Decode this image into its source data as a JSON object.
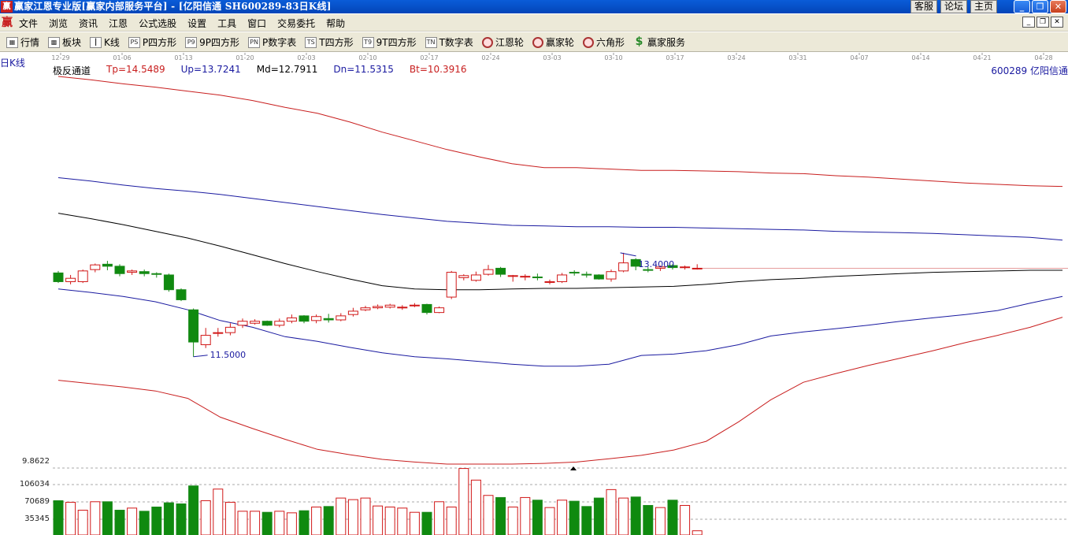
{
  "window": {
    "title": "赢家江恩专业版[赢家内部服务平台] - [亿阳信通   SH600289-83日K线]",
    "app_icon": "赢",
    "links": [
      "客服",
      "论坛",
      "主页"
    ],
    "buttons": {
      "minimize": "_",
      "restore": "❐",
      "close": "✕"
    }
  },
  "menu": {
    "logo": "赢",
    "items": [
      "文件",
      "浏览",
      "资讯",
      "江恩",
      "公式选股",
      "设置",
      "工具",
      "窗口",
      "交易委托",
      "帮助"
    ]
  },
  "toolbar": {
    "items": [
      {
        "label": "行情",
        "icon": "grid-icon",
        "glyph": "▦"
      },
      {
        "label": "板块",
        "icon": "blocks-icon",
        "glyph": "▩"
      },
      {
        "label": "K线",
        "icon": "candlestick-icon",
        "glyph": "┃"
      },
      {
        "label": "P四方形",
        "icon": "ps-icon",
        "glyph": "PS"
      },
      {
        "label": "9P四方形",
        "icon": "p9-icon",
        "glyph": "P9"
      },
      {
        "label": "P数字表",
        "icon": "pn-icon",
        "glyph": "PN"
      },
      {
        "label": "T四方形",
        "icon": "ts-icon",
        "glyph": "TS"
      },
      {
        "label": "9T四方形",
        "icon": "t9-icon",
        "glyph": "T9"
      },
      {
        "label": "T数字表",
        "icon": "tn-icon",
        "glyph": "TN"
      },
      {
        "label": "江恩轮",
        "icon": "gann-wheel-icon",
        "glyph": ""
      },
      {
        "label": "赢家轮",
        "icon": "winner-wheel-icon",
        "glyph": ""
      },
      {
        "label": "六角形",
        "icon": "hexagon-icon",
        "glyph": ""
      },
      {
        "label": "赢家服务",
        "icon": "dollar-icon",
        "glyph": "$"
      }
    ]
  },
  "chart_header": {
    "period": "日K线",
    "indicator_name": "极反通道",
    "indicator_values": [
      {
        "label": "Tp=14.5489",
        "color": "#c81e1e"
      },
      {
        "label": "Up=13.7241",
        "color": "#1a1aa0"
      },
      {
        "label": "Md=12.7911",
        "color": "#000000"
      },
      {
        "label": "Dn=11.5315",
        "color": "#1a1aa0"
      },
      {
        "label": "Bt=10.3916",
        "color": "#c81e1e"
      }
    ],
    "stock": "600289 亿阳信通"
  },
  "chart_data": {
    "type": "candlestick",
    "date_ticks": [
      "12-29",
      "01-06",
      "01-13",
      "01-20",
      "02-03",
      "02-10",
      "02-17",
      "02-24",
      "03-03",
      "03-10",
      "03-17",
      "03-24",
      "03-31",
      "04-07",
      "04-14",
      "04-21",
      "04-28"
    ],
    "annotations": {
      "low_marker": "11.5000",
      "high_marker": "13.4000"
    },
    "candles": [
      [
        12.75,
        12.62,
        12.78,
        12.6
      ],
      [
        12.62,
        12.67,
        12.72,
        12.58
      ],
      [
        12.62,
        12.78,
        12.8,
        12.6
      ],
      [
        12.8,
        12.87,
        12.89,
        12.76
      ],
      [
        12.88,
        12.85,
        12.93,
        12.79
      ],
      [
        12.85,
        12.74,
        12.88,
        12.7
      ],
      [
        12.76,
        12.78,
        12.8,
        12.72
      ],
      [
        12.77,
        12.74,
        12.8,
        12.7
      ],
      [
        12.74,
        12.73,
        12.76,
        12.68
      ],
      [
        12.72,
        12.5,
        12.74,
        12.47
      ],
      [
        12.5,
        12.35,
        12.52,
        12.33
      ],
      [
        12.2,
        11.72,
        12.22,
        11.5
      ],
      [
        11.68,
        11.82,
        11.93,
        11.63
      ],
      [
        11.85,
        11.86,
        11.93,
        11.8
      ],
      [
        11.86,
        11.94,
        12.0,
        11.82
      ],
      [
        11.97,
        12.03,
        12.07,
        11.93
      ],
      [
        12.0,
        12.03,
        12.06,
        11.98
      ],
      [
        12.03,
        11.97,
        12.04,
        11.96
      ],
      [
        11.97,
        12.03,
        12.07,
        11.94
      ],
      [
        12.03,
        12.08,
        12.13,
        12.0
      ],
      [
        12.11,
        12.03,
        12.12,
        12.0
      ],
      [
        12.04,
        12.1,
        12.13,
        12.0
      ],
      [
        12.07,
        12.05,
        12.14,
        12.01
      ],
      [
        12.05,
        12.11,
        12.15,
        12.03
      ],
      [
        12.13,
        12.18,
        12.23,
        12.1
      ],
      [
        12.2,
        12.23,
        12.26,
        12.18
      ],
      [
        12.23,
        12.25,
        12.28,
        12.21
      ],
      [
        12.24,
        12.27,
        12.29,
        12.22
      ],
      [
        12.23,
        12.24,
        12.27,
        12.2
      ],
      [
        12.26,
        12.27,
        12.3,
        12.24
      ],
      [
        12.28,
        12.16,
        12.29,
        12.13
      ],
      [
        12.16,
        12.23,
        12.25,
        12.15
      ],
      [
        12.39,
        12.76,
        12.78,
        12.36
      ],
      [
        12.68,
        12.71,
        12.73,
        12.64
      ],
      [
        12.64,
        12.72,
        12.77,
        12.62
      ],
      [
        12.73,
        12.8,
        12.87,
        12.71
      ],
      [
        12.82,
        12.73,
        12.84,
        12.69
      ],
      [
        12.7,
        12.71,
        12.72,
        12.62
      ],
      [
        12.69,
        12.7,
        12.73,
        12.64
      ],
      [
        12.69,
        12.68,
        12.74,
        12.64
      ],
      [
        12.62,
        12.62,
        12.65,
        12.58
      ],
      [
        12.62,
        12.72,
        12.75,
        12.6
      ],
      [
        12.76,
        12.75,
        12.79,
        12.71
      ],
      [
        12.73,
        12.72,
        12.77,
        12.68
      ],
      [
        12.72,
        12.66,
        12.73,
        12.65
      ],
      [
        12.66,
        12.77,
        12.8,
        12.62
      ],
      [
        12.78,
        12.9,
        13.05,
        12.76
      ],
      [
        12.95,
        12.85,
        12.97,
        12.79
      ],
      [
        12.8,
        12.79,
        12.84,
        12.76
      ],
      [
        12.82,
        12.84,
        12.86,
        12.78
      ],
      [
        12.86,
        12.83,
        12.88,
        12.8
      ],
      [
        12.83,
        12.84,
        12.86,
        12.8
      ],
      [
        12.82,
        12.82,
        12.88,
        12.8
      ]
    ],
    "channel": {
      "Tp": [
        15.68,
        15.63,
        15.57,
        15.52,
        15.46,
        15.4,
        15.32,
        15.22,
        15.13,
        15.0,
        14.85,
        14.72,
        14.59,
        14.48,
        14.38,
        14.32,
        14.32,
        14.3,
        14.28,
        14.28,
        14.27,
        14.26,
        14.24,
        14.23,
        14.2,
        14.18,
        14.15,
        14.12,
        14.09,
        14.07,
        14.05,
        14.04
      ],
      "Up": [
        14.17,
        14.12,
        14.06,
        14.01,
        13.97,
        13.92,
        13.86,
        13.8,
        13.74,
        13.68,
        13.62,
        13.57,
        13.52,
        13.49,
        13.46,
        13.45,
        13.44,
        13.44,
        13.43,
        13.43,
        13.42,
        13.41,
        13.4,
        13.39,
        13.37,
        13.36,
        13.35,
        13.34,
        13.32,
        13.3,
        13.28,
        13.24
      ],
      "Md": [
        13.64,
        13.56,
        13.47,
        13.37,
        13.27,
        13.15,
        13.02,
        12.89,
        12.77,
        12.66,
        12.56,
        12.51,
        12.5,
        12.5,
        12.51,
        12.52,
        12.52,
        12.53,
        12.54,
        12.55,
        12.58,
        12.62,
        12.65,
        12.67,
        12.7,
        12.72,
        12.74,
        12.76,
        12.77,
        12.78,
        12.79,
        12.79
      ],
      "Dn": [
        12.51,
        12.46,
        12.4,
        12.32,
        12.2,
        12.04,
        11.94,
        11.8,
        11.73,
        11.64,
        11.56,
        11.5,
        11.47,
        11.43,
        11.39,
        11.36,
        11.36,
        11.39,
        11.52,
        11.54,
        11.59,
        11.68,
        11.81,
        11.87,
        11.92,
        11.97,
        12.03,
        12.08,
        12.13,
        12.19,
        12.3,
        12.4
      ],
      "Bt": [
        11.15,
        11.1,
        11.05,
        10.99,
        10.88,
        10.6,
        10.43,
        10.27,
        10.12,
        10.04,
        9.97,
        9.93,
        9.9,
        9.9,
        9.9,
        9.91,
        9.93,
        9.98,
        10.03,
        10.11,
        10.24,
        10.53,
        10.86,
        11.12,
        11.25,
        11.37,
        11.48,
        11.59,
        11.71,
        11.82,
        11.94,
        12.09
      ]
    },
    "volume": {
      "ticks": [
        "9.8622",
        "106034",
        "70689",
        "35345"
      ],
      "bars": [
        65,
        62,
        47,
        63,
        63,
        47,
        51,
        45,
        53,
        61,
        59,
        93,
        65,
        87,
        62,
        45,
        45,
        43,
        45,
        42,
        46,
        53,
        54,
        70,
        67,
        70,
        55,
        53,
        51,
        43,
        43,
        63,
        53,
        126,
        104,
        75,
        71,
        53,
        71,
        66,
        52,
        66,
        64,
        54,
        70,
        86,
        70,
        72,
        56,
        52,
        66,
        56,
        8
      ]
    }
  }
}
